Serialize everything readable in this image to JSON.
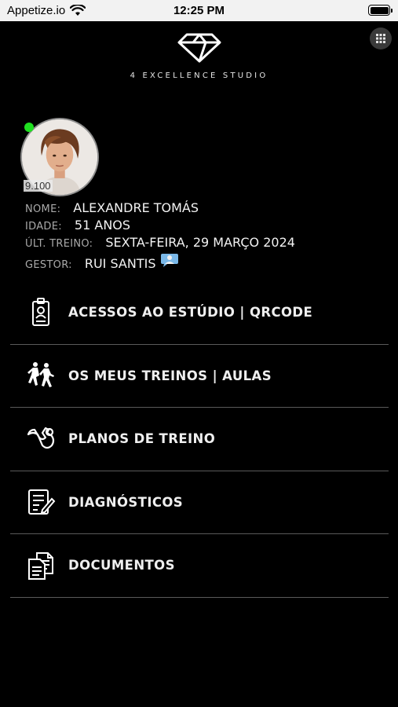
{
  "status_bar": {
    "carrier": "Appetize.io",
    "time": "12:25 PM"
  },
  "header": {
    "brand_name": "4 EXCELLENCE STUDIO",
    "logo_icon": "diamond-icon",
    "apps_icon": "grid-icon"
  },
  "profile": {
    "online_color": "#1fe020",
    "score": "9.100",
    "rows": [
      {
        "label": "NOME:",
        "value": "ALEXANDRE TOMÁS"
      },
      {
        "label": "IDADE:",
        "value": "51 ANOS"
      },
      {
        "label": "ÚLT. TREINO:",
        "value": "SEXTA-FEIRA, 29 MARÇO 2024"
      },
      {
        "label": "GESTOR:",
        "value": "RUI SANTIS"
      }
    ]
  },
  "menu": {
    "items": [
      {
        "label": "ACESSOS AO ESTÚDIO | QRCODE",
        "icon": "id-badge-icon"
      },
      {
        "label": "OS MEUS TREINOS | AULAS",
        "icon": "runners-icon"
      },
      {
        "label": "PLANOS DE TREINO",
        "icon": "muscle-arm-icon"
      },
      {
        "label": "DIAGNÓSTICOS",
        "icon": "clipboard-edit-icon"
      },
      {
        "label": "DOCUMENTOS",
        "icon": "documents-icon"
      }
    ]
  }
}
